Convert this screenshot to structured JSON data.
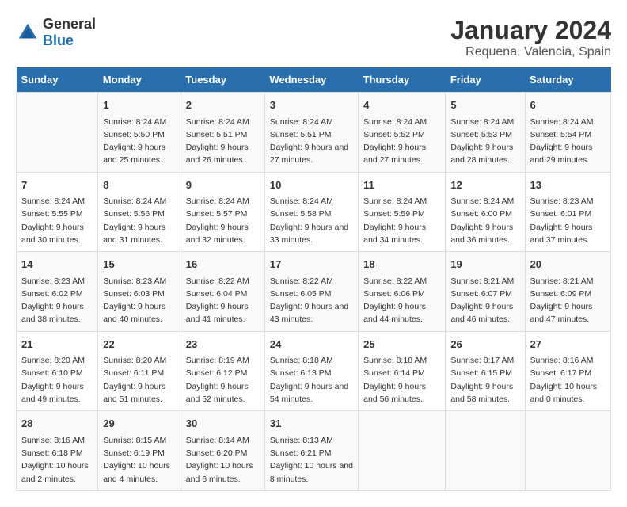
{
  "logo": {
    "general": "General",
    "blue": "Blue"
  },
  "title": "January 2024",
  "subtitle": "Requena, Valencia, Spain",
  "weekdays": [
    "Sunday",
    "Monday",
    "Tuesday",
    "Wednesday",
    "Thursday",
    "Friday",
    "Saturday"
  ],
  "weeks": [
    [
      {
        "day": "",
        "sunrise": "",
        "sunset": "",
        "daylight": ""
      },
      {
        "day": "1",
        "sunrise": "Sunrise: 8:24 AM",
        "sunset": "Sunset: 5:50 PM",
        "daylight": "Daylight: 9 hours and 25 minutes."
      },
      {
        "day": "2",
        "sunrise": "Sunrise: 8:24 AM",
        "sunset": "Sunset: 5:51 PM",
        "daylight": "Daylight: 9 hours and 26 minutes."
      },
      {
        "day": "3",
        "sunrise": "Sunrise: 8:24 AM",
        "sunset": "Sunset: 5:51 PM",
        "daylight": "Daylight: 9 hours and 27 minutes."
      },
      {
        "day": "4",
        "sunrise": "Sunrise: 8:24 AM",
        "sunset": "Sunset: 5:52 PM",
        "daylight": "Daylight: 9 hours and 27 minutes."
      },
      {
        "day": "5",
        "sunrise": "Sunrise: 8:24 AM",
        "sunset": "Sunset: 5:53 PM",
        "daylight": "Daylight: 9 hours and 28 minutes."
      },
      {
        "day": "6",
        "sunrise": "Sunrise: 8:24 AM",
        "sunset": "Sunset: 5:54 PM",
        "daylight": "Daylight: 9 hours and 29 minutes."
      }
    ],
    [
      {
        "day": "7",
        "sunrise": "Sunrise: 8:24 AM",
        "sunset": "Sunset: 5:55 PM",
        "daylight": "Daylight: 9 hours and 30 minutes."
      },
      {
        "day": "8",
        "sunrise": "Sunrise: 8:24 AM",
        "sunset": "Sunset: 5:56 PM",
        "daylight": "Daylight: 9 hours and 31 minutes."
      },
      {
        "day": "9",
        "sunrise": "Sunrise: 8:24 AM",
        "sunset": "Sunset: 5:57 PM",
        "daylight": "Daylight: 9 hours and 32 minutes."
      },
      {
        "day": "10",
        "sunrise": "Sunrise: 8:24 AM",
        "sunset": "Sunset: 5:58 PM",
        "daylight": "Daylight: 9 hours and 33 minutes."
      },
      {
        "day": "11",
        "sunrise": "Sunrise: 8:24 AM",
        "sunset": "Sunset: 5:59 PM",
        "daylight": "Daylight: 9 hours and 34 minutes."
      },
      {
        "day": "12",
        "sunrise": "Sunrise: 8:24 AM",
        "sunset": "Sunset: 6:00 PM",
        "daylight": "Daylight: 9 hours and 36 minutes."
      },
      {
        "day": "13",
        "sunrise": "Sunrise: 8:23 AM",
        "sunset": "Sunset: 6:01 PM",
        "daylight": "Daylight: 9 hours and 37 minutes."
      }
    ],
    [
      {
        "day": "14",
        "sunrise": "Sunrise: 8:23 AM",
        "sunset": "Sunset: 6:02 PM",
        "daylight": "Daylight: 9 hours and 38 minutes."
      },
      {
        "day": "15",
        "sunrise": "Sunrise: 8:23 AM",
        "sunset": "Sunset: 6:03 PM",
        "daylight": "Daylight: 9 hours and 40 minutes."
      },
      {
        "day": "16",
        "sunrise": "Sunrise: 8:22 AM",
        "sunset": "Sunset: 6:04 PM",
        "daylight": "Daylight: 9 hours and 41 minutes."
      },
      {
        "day": "17",
        "sunrise": "Sunrise: 8:22 AM",
        "sunset": "Sunset: 6:05 PM",
        "daylight": "Daylight: 9 hours and 43 minutes."
      },
      {
        "day": "18",
        "sunrise": "Sunrise: 8:22 AM",
        "sunset": "Sunset: 6:06 PM",
        "daylight": "Daylight: 9 hours and 44 minutes."
      },
      {
        "day": "19",
        "sunrise": "Sunrise: 8:21 AM",
        "sunset": "Sunset: 6:07 PM",
        "daylight": "Daylight: 9 hours and 46 minutes."
      },
      {
        "day": "20",
        "sunrise": "Sunrise: 8:21 AM",
        "sunset": "Sunset: 6:09 PM",
        "daylight": "Daylight: 9 hours and 47 minutes."
      }
    ],
    [
      {
        "day": "21",
        "sunrise": "Sunrise: 8:20 AM",
        "sunset": "Sunset: 6:10 PM",
        "daylight": "Daylight: 9 hours and 49 minutes."
      },
      {
        "day": "22",
        "sunrise": "Sunrise: 8:20 AM",
        "sunset": "Sunset: 6:11 PM",
        "daylight": "Daylight: 9 hours and 51 minutes."
      },
      {
        "day": "23",
        "sunrise": "Sunrise: 8:19 AM",
        "sunset": "Sunset: 6:12 PM",
        "daylight": "Daylight: 9 hours and 52 minutes."
      },
      {
        "day": "24",
        "sunrise": "Sunrise: 8:18 AM",
        "sunset": "Sunset: 6:13 PM",
        "daylight": "Daylight: 9 hours and 54 minutes."
      },
      {
        "day": "25",
        "sunrise": "Sunrise: 8:18 AM",
        "sunset": "Sunset: 6:14 PM",
        "daylight": "Daylight: 9 hours and 56 minutes."
      },
      {
        "day": "26",
        "sunrise": "Sunrise: 8:17 AM",
        "sunset": "Sunset: 6:15 PM",
        "daylight": "Daylight: 9 hours and 58 minutes."
      },
      {
        "day": "27",
        "sunrise": "Sunrise: 8:16 AM",
        "sunset": "Sunset: 6:17 PM",
        "daylight": "Daylight: 10 hours and 0 minutes."
      }
    ],
    [
      {
        "day": "28",
        "sunrise": "Sunrise: 8:16 AM",
        "sunset": "Sunset: 6:18 PM",
        "daylight": "Daylight: 10 hours and 2 minutes."
      },
      {
        "day": "29",
        "sunrise": "Sunrise: 8:15 AM",
        "sunset": "Sunset: 6:19 PM",
        "daylight": "Daylight: 10 hours and 4 minutes."
      },
      {
        "day": "30",
        "sunrise": "Sunrise: 8:14 AM",
        "sunset": "Sunset: 6:20 PM",
        "daylight": "Daylight: 10 hours and 6 minutes."
      },
      {
        "day": "31",
        "sunrise": "Sunrise: 8:13 AM",
        "sunset": "Sunset: 6:21 PM",
        "daylight": "Daylight: 10 hours and 8 minutes."
      },
      {
        "day": "",
        "sunrise": "",
        "sunset": "",
        "daylight": ""
      },
      {
        "day": "",
        "sunrise": "",
        "sunset": "",
        "daylight": ""
      },
      {
        "day": "",
        "sunrise": "",
        "sunset": "",
        "daylight": ""
      }
    ]
  ]
}
